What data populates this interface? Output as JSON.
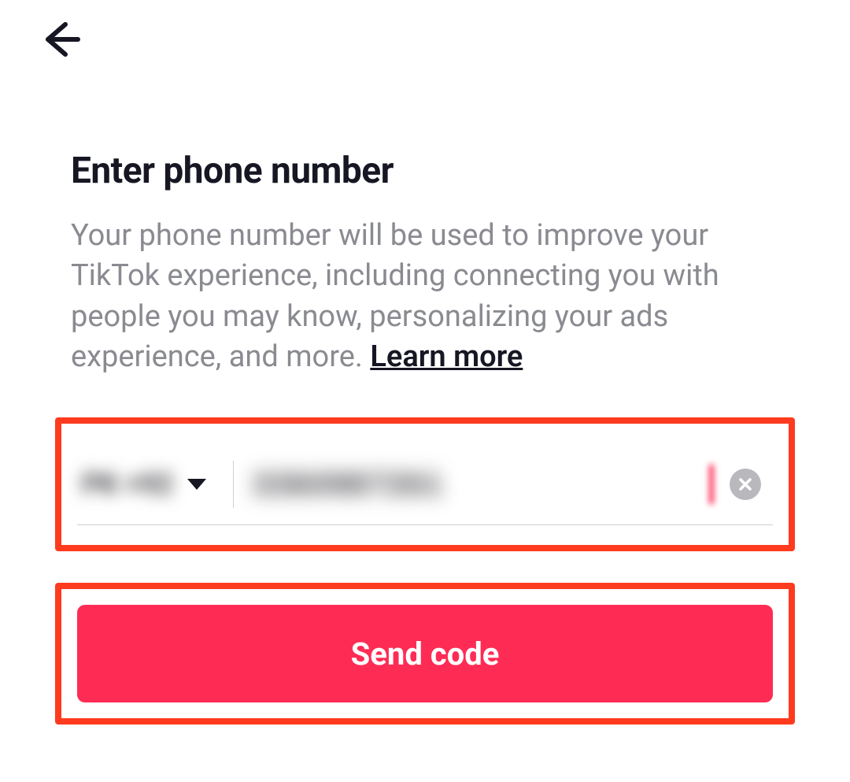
{
  "header": {
    "back_icon": "arrow-left"
  },
  "main": {
    "title": "Enter phone number",
    "description_prefix": "Your phone number will be used to improve your TikTok experience, including connecting you with people you may know, personalizing your ads experience, and more. ",
    "learn_more_label": "Learn more"
  },
  "phone_input": {
    "country_code_display": "PK +92",
    "value": "3360987261",
    "clear_icon": "x"
  },
  "actions": {
    "send_code_label": "Send code"
  },
  "colors": {
    "accent": "#fe2c55",
    "highlight": "#ff3b1f",
    "text_primary": "#161723",
    "text_secondary": "#8a8b91"
  }
}
